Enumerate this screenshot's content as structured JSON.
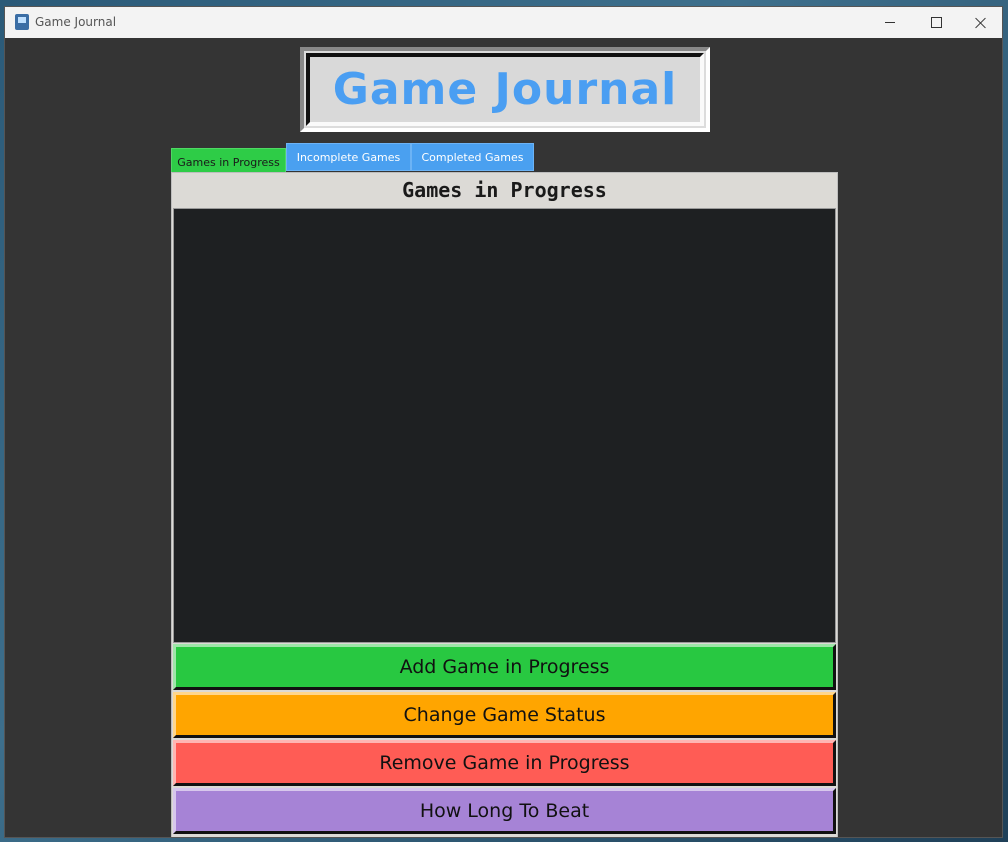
{
  "window": {
    "title": "Game Journal"
  },
  "logo": {
    "text": "Game Journal"
  },
  "tabs": [
    {
      "label": "Games in Progress",
      "active": true
    },
    {
      "label": "Incomplete Games",
      "active": false
    },
    {
      "label": "Completed Games",
      "active": false
    }
  ],
  "panel": {
    "title": "Games in Progress",
    "items": []
  },
  "buttons": {
    "add": "Add Game in Progress",
    "change": "Change Game Status",
    "remove": "Remove Game in Progress",
    "hltb": "How Long To Beat"
  },
  "colors": {
    "active_tab": "#2ecc47",
    "inactive_tab": "#4aa0f0",
    "add_button": "#28c841",
    "change_button": "#ffa500",
    "remove_button": "#ff5c55",
    "hltb_button": "#a683d6",
    "logo_text": "#4a9ef2",
    "list_background": "#1e2022"
  }
}
